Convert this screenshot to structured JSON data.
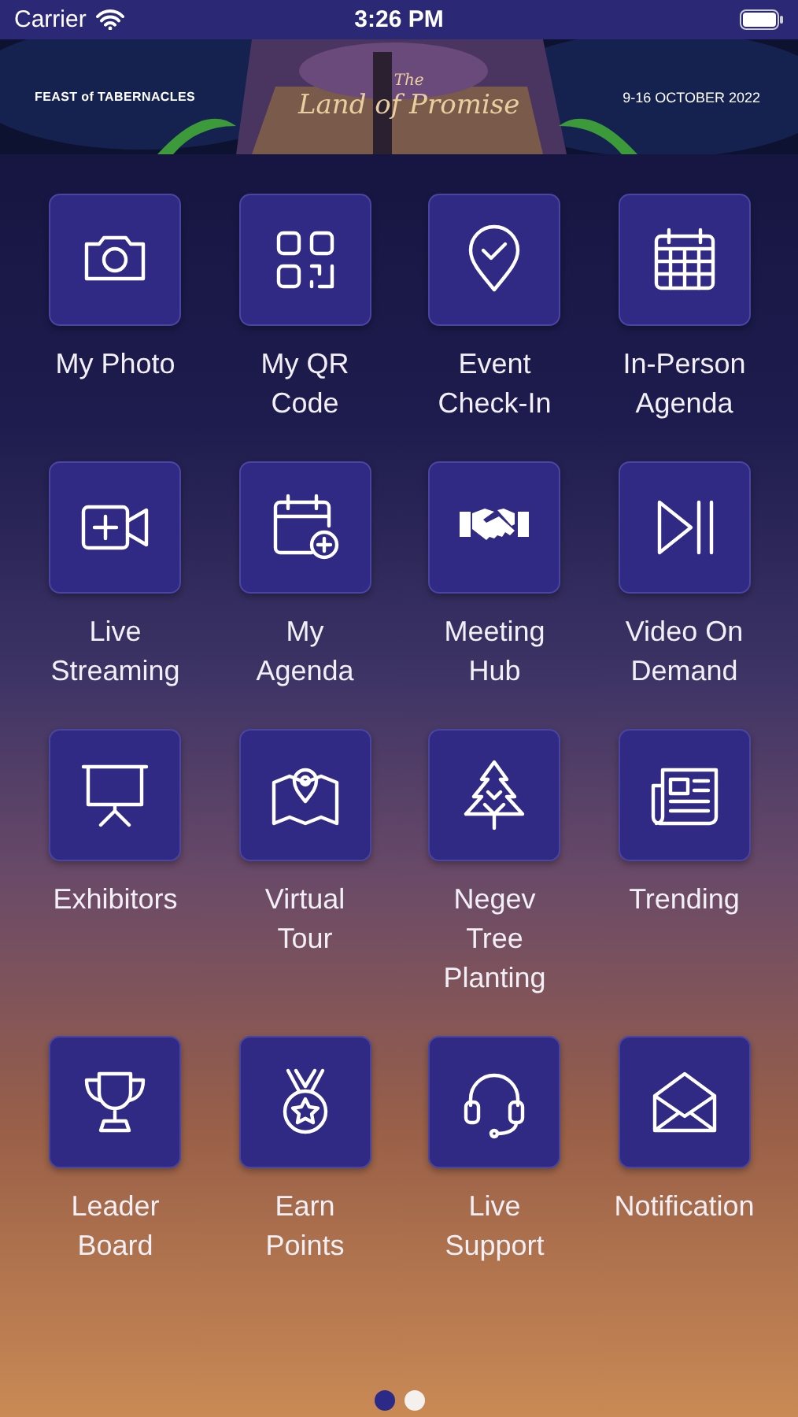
{
  "status_bar": {
    "carrier": "Carrier",
    "time": "3:26 PM"
  },
  "banner": {
    "left": "FEAST of TABERNACLES",
    "title_small": "The",
    "title": "Land of Promise",
    "dates": "9-16 OCTOBER 2022"
  },
  "tiles": [
    {
      "label": [
        "My Photo"
      ]
    },
    {
      "label": [
        "My QR",
        "Code"
      ]
    },
    {
      "label": [
        "Event",
        "Check-In"
      ]
    },
    {
      "label": [
        "In-Person",
        "Agenda"
      ]
    },
    {
      "label": [
        "Live",
        "Streaming"
      ]
    },
    {
      "label": [
        "My",
        "Agenda"
      ]
    },
    {
      "label": [
        "Meeting",
        "Hub"
      ]
    },
    {
      "label": [
        "Video On",
        "Demand"
      ]
    },
    {
      "label": [
        "Exhibitors"
      ]
    },
    {
      "label": [
        "Virtual",
        "Tour"
      ]
    },
    {
      "label": [
        "Negev",
        "Tree",
        "Planting"
      ]
    },
    {
      "label": [
        "Trending"
      ]
    },
    {
      "label": [
        "Leader",
        "Board"
      ]
    },
    {
      "label": [
        "Earn",
        "Points"
      ]
    },
    {
      "label": [
        "Live",
        "Support"
      ]
    },
    {
      "label": [
        "Notification"
      ]
    }
  ],
  "page_dots": [
    {
      "selected": true
    },
    {
      "selected": false
    }
  ]
}
